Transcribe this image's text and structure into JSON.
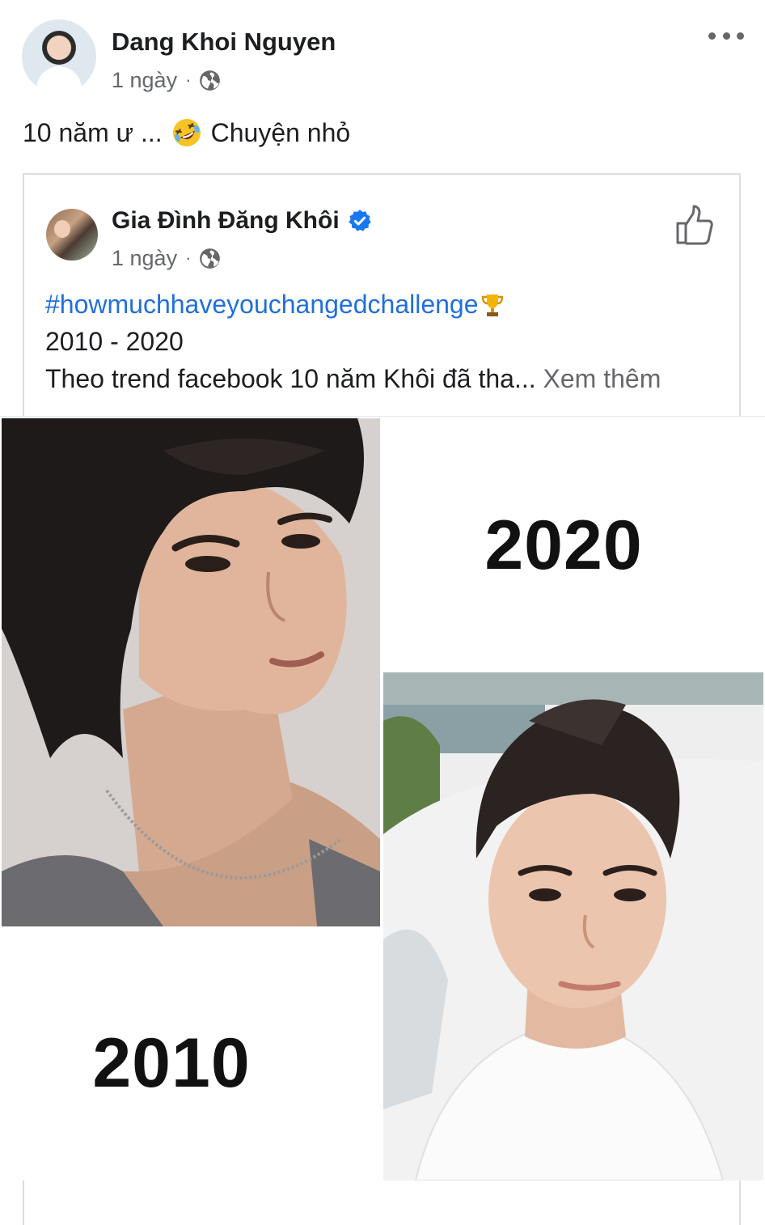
{
  "post": {
    "author": "Dang Khoi Nguyen",
    "time": "1 ngày",
    "separator": "·",
    "text_before": "10 năm ư ...",
    "emoji": "rolling-on-the-floor-laughing",
    "text_after": "Chuyện nhỏ"
  },
  "shared_post": {
    "author": "Gia Đình Đăng Khôi",
    "verified": true,
    "time": "1 ngày",
    "separator": "·",
    "hashtag": "#howmuchhaveyouchangedchallenge",
    "line2": "2010 - 2020",
    "line3": "Theo trend facebook 10 năm Khôi đã tha...",
    "see_more": "Xem thêm"
  },
  "photos": {
    "label_new": "2020",
    "label_old": "2010"
  },
  "colors": {
    "link": "#216fdb",
    "verified_badge": "#1877f2",
    "meta_text": "#65676b",
    "border": "#dadde1"
  },
  "icons": [
    "globe-icon",
    "more-options-icon",
    "verified-badge-icon",
    "like-icon",
    "trophy-icon"
  ]
}
